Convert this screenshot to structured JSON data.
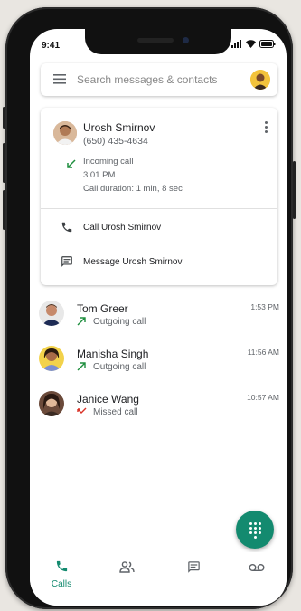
{
  "status_bar": {
    "time": "9:41"
  },
  "search": {
    "placeholder": "Search messages & contacts"
  },
  "contact_card": {
    "name": "Urosh Smirnov",
    "phone": "(650) 435-4634",
    "call_type": "Incoming call",
    "call_time": "3:01 PM",
    "call_duration": "Call duration: 1 min, 8 sec",
    "actions": [
      {
        "label": "Call Urosh Smirnov",
        "icon": "phone-icon"
      },
      {
        "label": "Message Urosh Smirnov",
        "icon": "message-icon"
      }
    ]
  },
  "call_log": [
    {
      "name": "Tom Greer",
      "type": "Outgoing call",
      "time": "1:53 PM",
      "icon": "outgoing-call-icon"
    },
    {
      "name": "Manisha Singh",
      "type": "Outgoing call",
      "time": "11:56 AM",
      "icon": "outgoing-call-icon"
    },
    {
      "name": "Janice Wang",
      "type": "Missed call",
      "time": "10:57 AM",
      "icon": "missed-call-icon"
    }
  ],
  "bottom_nav": [
    {
      "label": "Calls",
      "icon": "phone-icon",
      "active": true
    },
    {
      "label": "",
      "icon": "contacts-icon",
      "active": false
    },
    {
      "label": "",
      "icon": "messages-icon",
      "active": false
    },
    {
      "label": "",
      "icon": "voicemail-icon",
      "active": false
    }
  ],
  "colors": {
    "accent": "#138a6f",
    "outgoing": "#1e8e3e",
    "missed": "#d93025"
  }
}
